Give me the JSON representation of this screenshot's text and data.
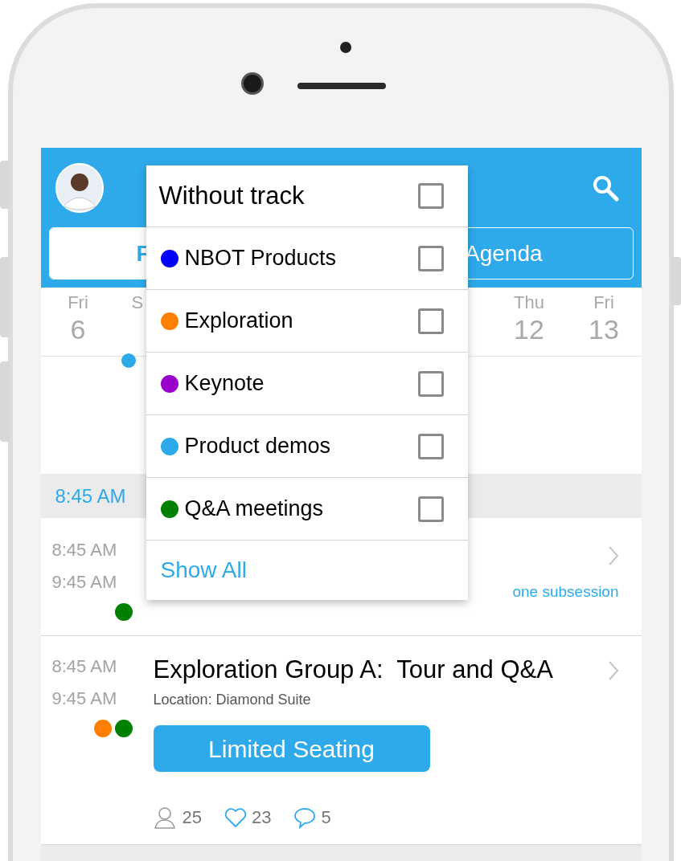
{
  "header": {
    "tabs": [
      {
        "label": "F",
        "selected": true
      },
      {
        "label": "Agenda",
        "selected": false
      }
    ]
  },
  "days": [
    {
      "weekday": "Fri",
      "date": "6"
    },
    {
      "weekday": "S",
      "events": [
        {
          "color": "#2eaaea"
        }
      ]
    },
    {
      "weekday": "Thu",
      "date": "12"
    },
    {
      "weekday": "Fri",
      "date": "13"
    }
  ],
  "track_filter": {
    "items": [
      {
        "label": "Without track",
        "checked": false
      },
      {
        "label": "NBOT Products",
        "color": "#0000ff",
        "checked": false
      },
      {
        "label": "Exploration",
        "color": "#ff8000",
        "checked": false
      },
      {
        "label": "Keynote",
        "color": "#9900cc",
        "checked": false
      },
      {
        "label": "Product demos",
        "color": "#2eaaea",
        "checked": false
      },
      {
        "label": "Q&A meetings",
        "color": "#008000",
        "checked": false
      }
    ],
    "show_all": "Show All"
  },
  "time_header": "8:45 AM",
  "sessions": [
    {
      "start": "8:45 AM",
      "end": "9:45 AM",
      "tracks": [
        {
          "color": "#008000"
        }
      ],
      "note": "one subsession"
    },
    {
      "start": "8:45 AM",
      "end": "9:45 AM",
      "title": "Exploration Group A:  Tour and Q&A",
      "location": "Location: Diamond Suite",
      "badge": "Limited Seating",
      "tracks": [
        {
          "color": "#ff8000"
        },
        {
          "color": "#008000"
        }
      ],
      "attendees": "25",
      "likes": "23",
      "comments": "5"
    }
  ]
}
